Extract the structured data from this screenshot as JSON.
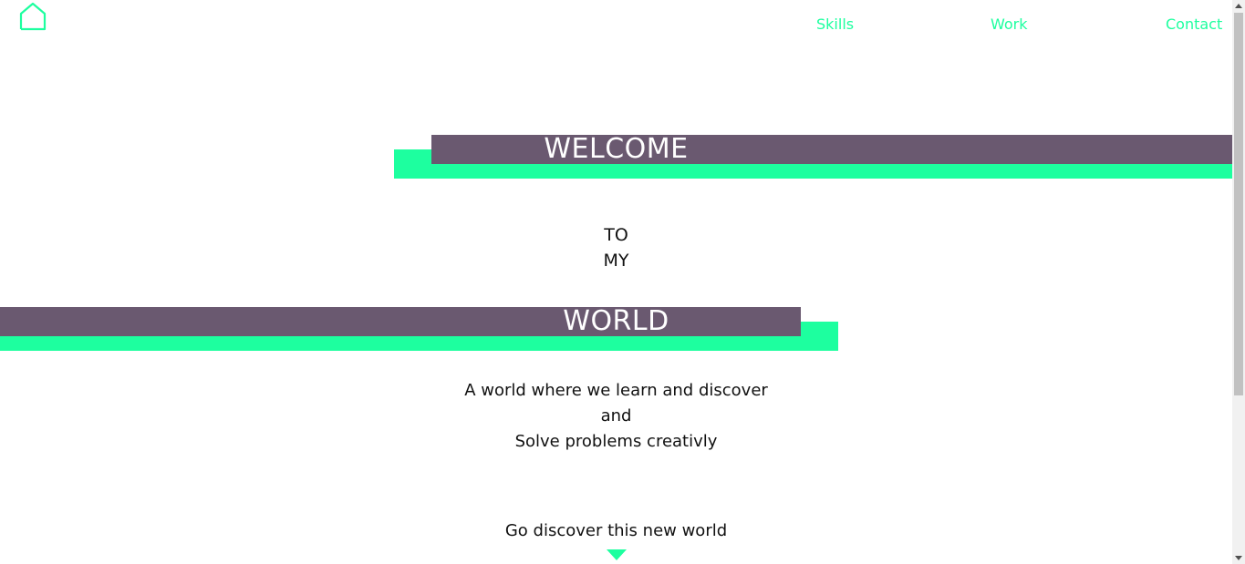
{
  "nav": {
    "home_icon": "home-icon",
    "links": [
      {
        "label": "Skills"
      },
      {
        "label": "Work"
      },
      {
        "label": "Contact"
      }
    ]
  },
  "hero": {
    "welcome": "WELCOME",
    "to": "TO",
    "my": "MY",
    "world": "WORLD",
    "tagline": [
      "A world where we learn and discover",
      "and",
      "Solve problems creativly"
    ],
    "cta": "Go discover this new world"
  },
  "colors": {
    "accent_green": "#1dff9f",
    "accent_purple": "#6a5970"
  }
}
